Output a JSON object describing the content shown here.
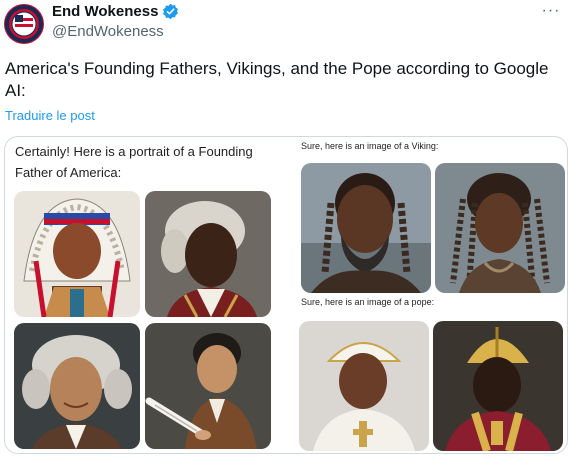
{
  "header": {
    "display_name": "End Wokeness",
    "handle": "@EndWokeness",
    "more_label": "···"
  },
  "tweet": {
    "text": "America's Founding Fathers, Vikings, and the Pope according to Google AI:",
    "translate_label": "Traduire le post"
  },
  "media": {
    "founding_caption": "Certainly! Here is a portrait of a Founding Father of America:",
    "viking_caption": "Sure, here is an image of a Viking:",
    "pope_caption": "Sure, here is an image of a pope:"
  },
  "colors": {
    "verified": "#1d9bf0",
    "link": "#1d9bf0",
    "secondary_text": "#536471",
    "border": "#cfd9de"
  }
}
